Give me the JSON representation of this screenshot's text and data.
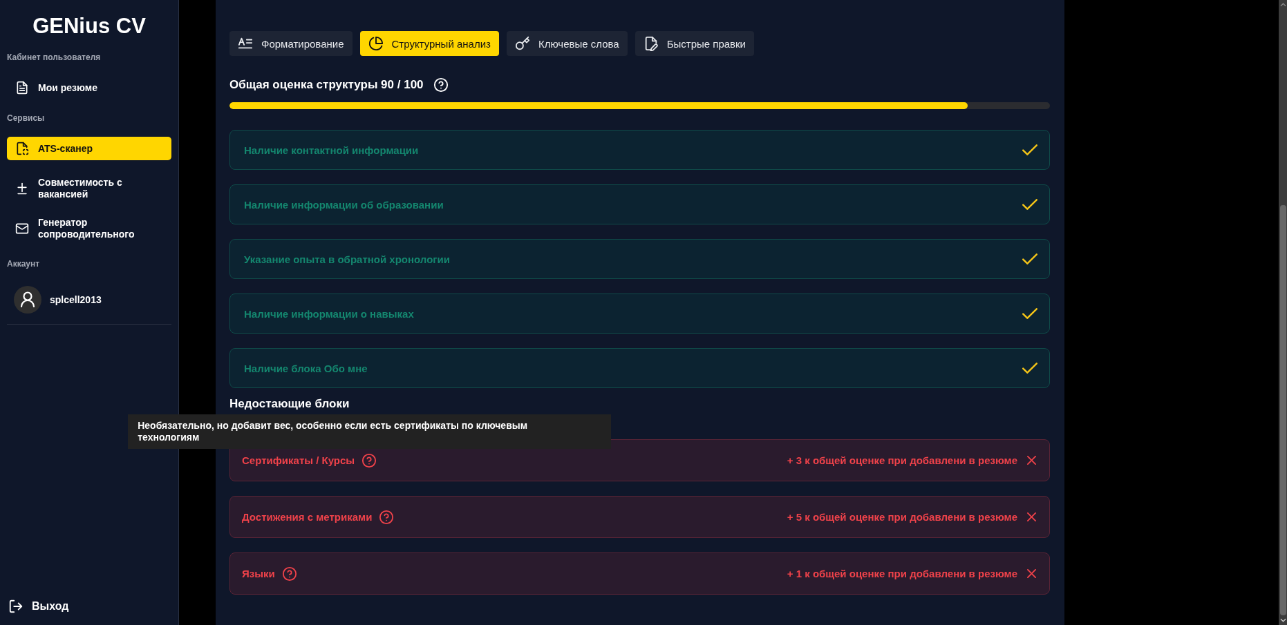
{
  "sidebar": {
    "logo": "GENius CV",
    "sections": [
      {
        "title": "Кабинет пользователя",
        "items": [
          {
            "label": "Мои резюме",
            "selected": false
          }
        ]
      },
      {
        "title": "Сервисы",
        "items": [
          {
            "label": "ATS-сканер",
            "selected": true
          },
          {
            "label": "Совместимость с вакансией",
            "selected": false
          },
          {
            "label": "Генератор сопроводительного",
            "selected": false
          }
        ]
      }
    ],
    "account": {
      "title": "Аккаунт",
      "username": "splcell2013"
    },
    "logout": "Выход"
  },
  "tabs": [
    {
      "label": "Форматирование",
      "selected": false
    },
    {
      "label": "Структурный анализ",
      "selected": true
    },
    {
      "label": "Ключевые слова",
      "selected": false
    },
    {
      "label": "Быстрые правки",
      "selected": false
    }
  ],
  "score": {
    "title": "Общая оценка структуры 90 / 100",
    "level": 0.9
  },
  "checks": [
    {
      "label": "Наличие контактной информации"
    },
    {
      "label": "Наличие информации об образовании"
    },
    {
      "label": "Указание опыта в обратной хронологии"
    },
    {
      "label": "Наличие информации о навыках"
    },
    {
      "label": "Наличие блока Обо мне"
    }
  ],
  "missing": {
    "title": "Недостающие блоки",
    "items": [
      {
        "label": "Сертификаты / Курсы",
        "bonus": "+ 3 к общей оценке при добавлени в резюме",
        "tooltip": "Необязательно, но добавит вес, особенно если есть сертификаты по ключевым технологиям"
      },
      {
        "label": "Достижения с метриками",
        "bonus": "+ 5 к общей оценке при добавлени в резюме"
      },
      {
        "label": "Языки",
        "bonus": "+ 1 к общей оценке при добавлени в резюме"
      }
    ]
  }
}
